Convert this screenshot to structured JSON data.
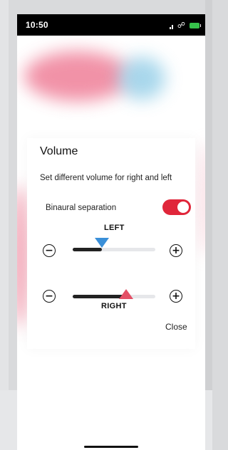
{
  "status_bar": {
    "time": "10:50",
    "icons": [
      "signal-icon",
      "link-icon",
      "battery-icon"
    ],
    "battery_color": "#36c24b"
  },
  "dialog": {
    "title": "Volume",
    "description": "Set different volume for right and left",
    "binaural_label": "Binaural separation",
    "binaural_enabled": true,
    "toggle_color": "#e0263a",
    "left": {
      "label": "LEFT",
      "level_percent": 35,
      "thumb_color": "#3a8fd8"
    },
    "right": {
      "label": "RIGHT",
      "level_percent": 65,
      "thumb_color": "#e45066"
    },
    "minus_icon": "−",
    "plus_icon": "+",
    "close_label": "Close"
  }
}
